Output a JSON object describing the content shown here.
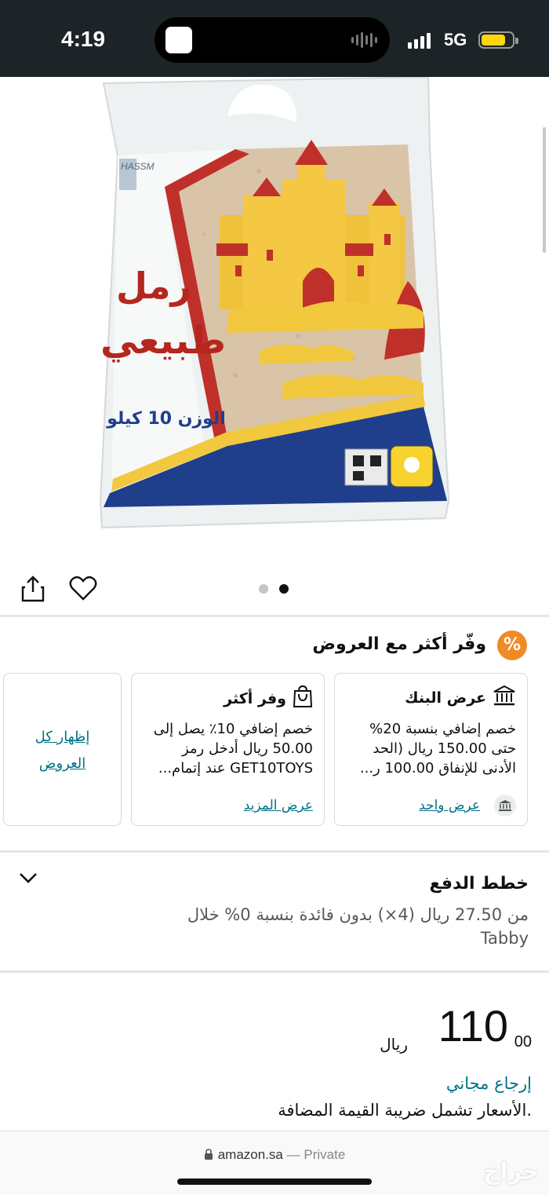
{
  "status_bar": {
    "time": "4:19",
    "network": "5G",
    "battery_level": 0.8
  },
  "product_image": {
    "brand": "HASSM",
    "title_line1": "رمل",
    "title_line2": "طبيعي",
    "weight_label": "الوزن 10 كيلو"
  },
  "gallery": {
    "dots_total": 2,
    "active_dot": 2
  },
  "offers": {
    "title": "وفّر أكثر مع العروض",
    "badge": "%",
    "bank_offer": {
      "title": "عرض البنك",
      "lines": [
        "خصم إضافي بنسبة 20%",
        "حتى 150.00 ريال (الحد",
        "الأدنى للإنفاق 100.00 ر..."
      ],
      "link": "عرض واحد"
    },
    "save_more": {
      "title": "وفر أكثر",
      "lines": [
        "خصم إضافي 10٪ يصل إلى",
        "50.00 ريال أدخل رمز",
        "GET10TOYS عند إتمام..."
      ],
      "link": "عرض المزيد"
    },
    "show_all": "إظهار كل العروض"
  },
  "payment_plans": {
    "title": "خطط الدفع",
    "description": "من 27.50 ريال (4×) بدون فائدة بنسبة 0% خلال Tabby"
  },
  "price": {
    "whole": "110",
    "fraction": "00",
    "currency": "ريال"
  },
  "free_return": "إرجاع مجاني",
  "vat_note": ".الأسعار تشمل ضريبة القيمة المضافة",
  "browser": {
    "domain": "amazon.sa",
    "separator": "—",
    "mode": "Private"
  },
  "watermark": "حراج"
}
